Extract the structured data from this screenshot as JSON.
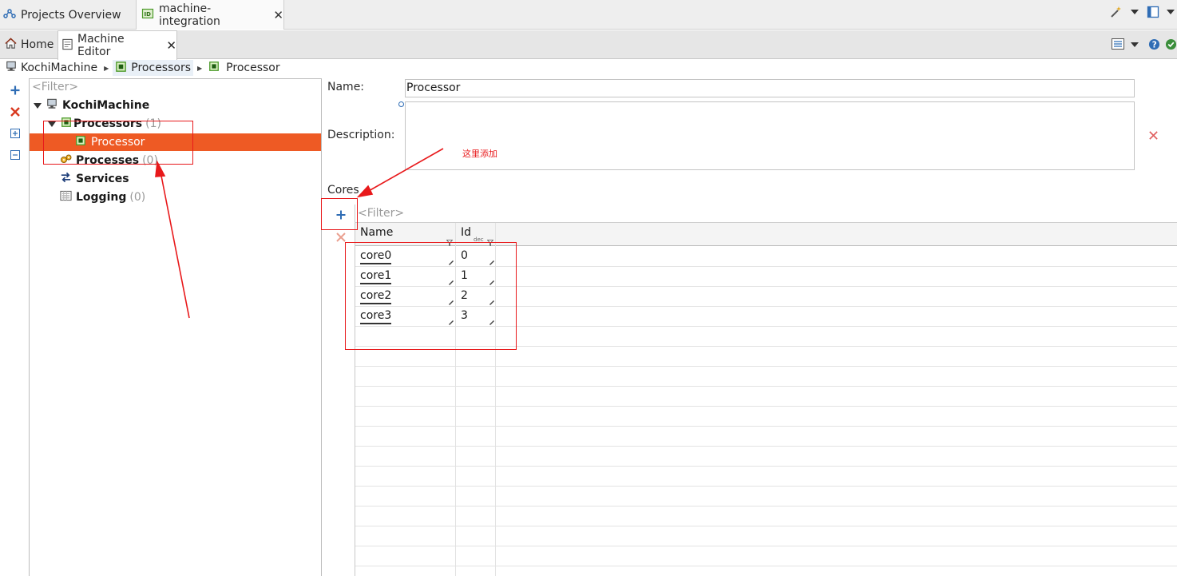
{
  "top_tabs": [
    {
      "label": "Projects Overview"
    },
    {
      "label": "machine-integration",
      "close": "✕"
    }
  ],
  "editor_tabs": [
    {
      "label": "Home"
    },
    {
      "label": "Machine Editor",
      "close": "✕"
    }
  ],
  "breadcrumb": [
    "KochiMachine",
    "Processors",
    "Processor"
  ],
  "tree": {
    "filter_placeholder": "<Filter>",
    "root": "KochiMachine",
    "items": [
      {
        "label": "Processors",
        "count": "(1)"
      },
      {
        "label": "Processor"
      },
      {
        "label": "Processes",
        "count": "(0)"
      },
      {
        "label": "Services"
      },
      {
        "label": "Logging",
        "count": "(0)"
      }
    ]
  },
  "form": {
    "name_label": "Name:",
    "name_value": "Processor",
    "description_label": "Description:",
    "description_value": "",
    "cores_label": "Cores",
    "cores_filter_placeholder": "<Filter>"
  },
  "cores_table": {
    "columns": [
      "Name",
      "Id"
    ],
    "id_sub": "dec",
    "rows": [
      {
        "name": "core0",
        "id": "0"
      },
      {
        "name": "core1",
        "id": "1"
      },
      {
        "name": "core2",
        "id": "2"
      },
      {
        "name": "core3",
        "id": "3"
      }
    ]
  },
  "annotation": {
    "text": "这里添加",
    "color": "#e8191b"
  },
  "colors": {
    "selection": "#ee5a24",
    "add": "#2f6db5",
    "remove": "#d9381e"
  }
}
